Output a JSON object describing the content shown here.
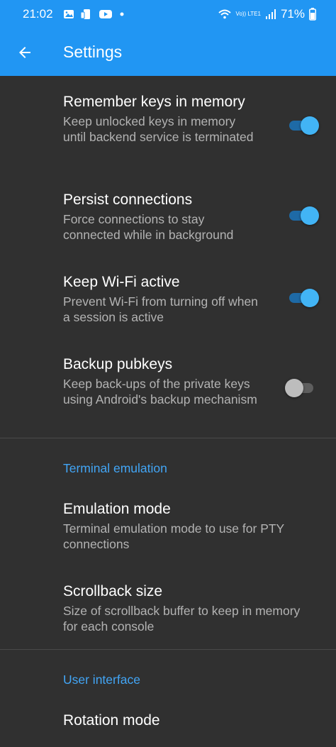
{
  "status": {
    "time": "21:02",
    "network": "Vo)) LTE1",
    "battery": "71%"
  },
  "app_bar": {
    "title": "Settings"
  },
  "prefs": [
    {
      "title": "Remember keys in memory",
      "summary": "Keep unlocked keys in memory until backend service is terminated",
      "enabled": true
    },
    {
      "title": "Persist connections",
      "summary": "Force connections to stay connected while in background",
      "enabled": true
    },
    {
      "title": "Keep Wi-Fi active",
      "summary": "Prevent Wi-Fi from turning off when a session is active",
      "enabled": true
    },
    {
      "title": "Backup pubkeys",
      "summary": "Keep back-ups of the private keys using Android's backup mechanism",
      "enabled": false
    }
  ],
  "terminal": {
    "category": "Terminal emulation",
    "emulation_title": "Emulation mode",
    "emulation_summary": "Terminal emulation mode to use for PTY connections",
    "scrollback_title": "Scrollback size",
    "scrollback_summary": "Size of scrollback buffer to keep in memory for each console"
  },
  "ui": {
    "category": "User interface",
    "rotation_title": "Rotation mode"
  },
  "colors": {
    "accent": "#2196f3",
    "switch_on": "#42b4f5",
    "background": "#303030"
  }
}
